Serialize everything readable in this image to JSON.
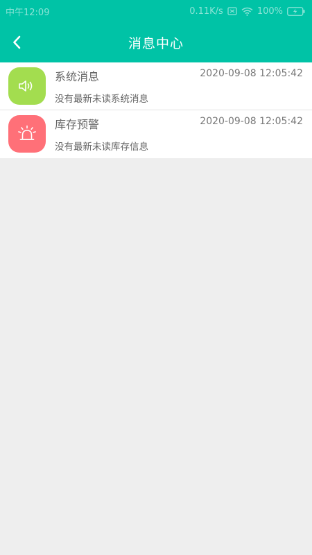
{
  "status_bar": {
    "time": "中午12:09",
    "network_speed": "0.11K/s",
    "battery": "100%"
  },
  "header": {
    "title": "消息中心",
    "back_icon": "chevron-left-icon"
  },
  "colors": {
    "primary": "#00c3a6",
    "system_icon_bg": "#a3dd4f",
    "stock_icon_bg": "#ff7078",
    "background": "#eeeeee"
  },
  "messages": [
    {
      "title": "系统消息",
      "time": "2020-09-08 12:05:42",
      "preview": "没有最新未读系统消息",
      "icon": "speaker-icon"
    },
    {
      "title": "库存预警",
      "time": "2020-09-08 12:05:42",
      "preview": "没有最新未读库存信息",
      "icon": "alarm-light-icon"
    }
  ]
}
